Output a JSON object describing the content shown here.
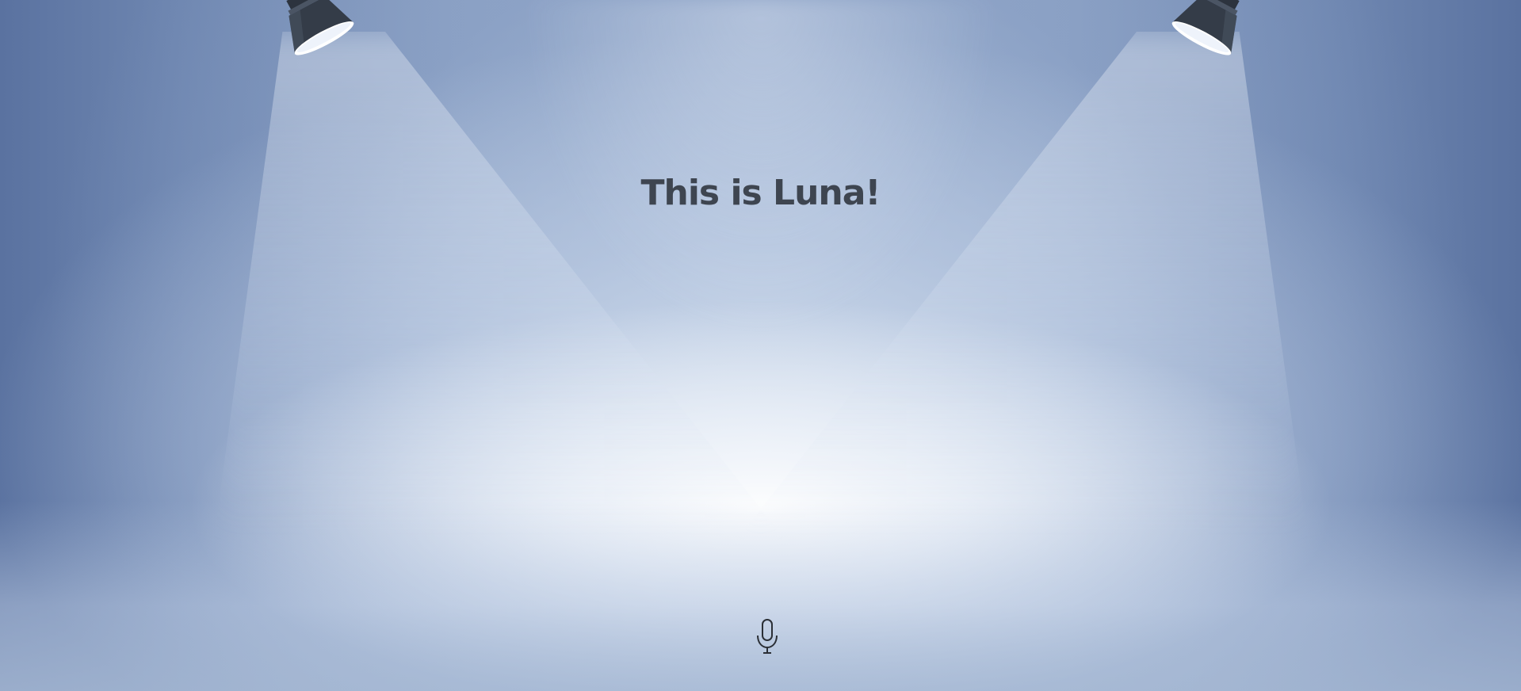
{
  "page": {
    "title": "This is Luna!"
  },
  "icons": {
    "left_spotlight": "spotlight-icon",
    "right_spotlight": "spotlight-icon",
    "microphone": "microphone-icon"
  },
  "colors": {
    "title_text": "#3e4550",
    "background": "#8aa0c3",
    "spotlight_body": "#343c48",
    "mic_stroke": "#2b2f36"
  }
}
